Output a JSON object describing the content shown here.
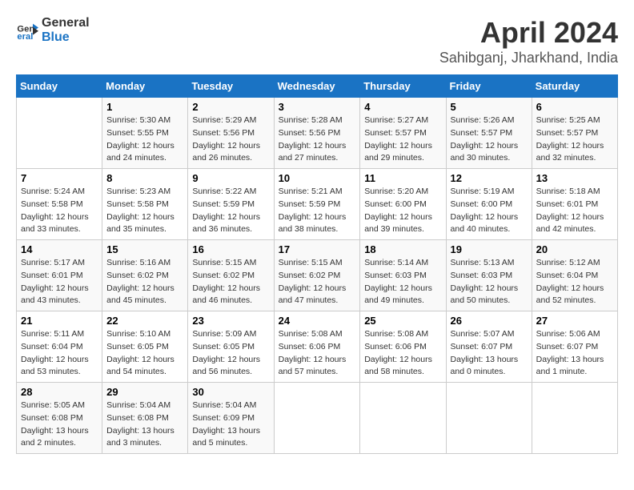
{
  "header": {
    "logo_line1": "General",
    "logo_line2": "Blue",
    "title": "April 2024",
    "subtitle": "Sahibganj, Jharkhand, India"
  },
  "weekdays": [
    "Sunday",
    "Monday",
    "Tuesday",
    "Wednesday",
    "Thursday",
    "Friday",
    "Saturday"
  ],
  "weeks": [
    [
      {
        "day": "",
        "detail": ""
      },
      {
        "day": "1",
        "detail": "Sunrise: 5:30 AM\nSunset: 5:55 PM\nDaylight: 12 hours\nand 24 minutes."
      },
      {
        "day": "2",
        "detail": "Sunrise: 5:29 AM\nSunset: 5:56 PM\nDaylight: 12 hours\nand 26 minutes."
      },
      {
        "day": "3",
        "detail": "Sunrise: 5:28 AM\nSunset: 5:56 PM\nDaylight: 12 hours\nand 27 minutes."
      },
      {
        "day": "4",
        "detail": "Sunrise: 5:27 AM\nSunset: 5:57 PM\nDaylight: 12 hours\nand 29 minutes."
      },
      {
        "day": "5",
        "detail": "Sunrise: 5:26 AM\nSunset: 5:57 PM\nDaylight: 12 hours\nand 30 minutes."
      },
      {
        "day": "6",
        "detail": "Sunrise: 5:25 AM\nSunset: 5:57 PM\nDaylight: 12 hours\nand 32 minutes."
      }
    ],
    [
      {
        "day": "7",
        "detail": "Sunrise: 5:24 AM\nSunset: 5:58 PM\nDaylight: 12 hours\nand 33 minutes."
      },
      {
        "day": "8",
        "detail": "Sunrise: 5:23 AM\nSunset: 5:58 PM\nDaylight: 12 hours\nand 35 minutes."
      },
      {
        "day": "9",
        "detail": "Sunrise: 5:22 AM\nSunset: 5:59 PM\nDaylight: 12 hours\nand 36 minutes."
      },
      {
        "day": "10",
        "detail": "Sunrise: 5:21 AM\nSunset: 5:59 PM\nDaylight: 12 hours\nand 38 minutes."
      },
      {
        "day": "11",
        "detail": "Sunrise: 5:20 AM\nSunset: 6:00 PM\nDaylight: 12 hours\nand 39 minutes."
      },
      {
        "day": "12",
        "detail": "Sunrise: 5:19 AM\nSunset: 6:00 PM\nDaylight: 12 hours\nand 40 minutes."
      },
      {
        "day": "13",
        "detail": "Sunrise: 5:18 AM\nSunset: 6:01 PM\nDaylight: 12 hours\nand 42 minutes."
      }
    ],
    [
      {
        "day": "14",
        "detail": "Sunrise: 5:17 AM\nSunset: 6:01 PM\nDaylight: 12 hours\nand 43 minutes."
      },
      {
        "day": "15",
        "detail": "Sunrise: 5:16 AM\nSunset: 6:02 PM\nDaylight: 12 hours\nand 45 minutes."
      },
      {
        "day": "16",
        "detail": "Sunrise: 5:15 AM\nSunset: 6:02 PM\nDaylight: 12 hours\nand 46 minutes."
      },
      {
        "day": "17",
        "detail": "Sunrise: 5:15 AM\nSunset: 6:02 PM\nDaylight: 12 hours\nand 47 minutes."
      },
      {
        "day": "18",
        "detail": "Sunrise: 5:14 AM\nSunset: 6:03 PM\nDaylight: 12 hours\nand 49 minutes."
      },
      {
        "day": "19",
        "detail": "Sunrise: 5:13 AM\nSunset: 6:03 PM\nDaylight: 12 hours\nand 50 minutes."
      },
      {
        "day": "20",
        "detail": "Sunrise: 5:12 AM\nSunset: 6:04 PM\nDaylight: 12 hours\nand 52 minutes."
      }
    ],
    [
      {
        "day": "21",
        "detail": "Sunrise: 5:11 AM\nSunset: 6:04 PM\nDaylight: 12 hours\nand 53 minutes."
      },
      {
        "day": "22",
        "detail": "Sunrise: 5:10 AM\nSunset: 6:05 PM\nDaylight: 12 hours\nand 54 minutes."
      },
      {
        "day": "23",
        "detail": "Sunrise: 5:09 AM\nSunset: 6:05 PM\nDaylight: 12 hours\nand 56 minutes."
      },
      {
        "day": "24",
        "detail": "Sunrise: 5:08 AM\nSunset: 6:06 PM\nDaylight: 12 hours\nand 57 minutes."
      },
      {
        "day": "25",
        "detail": "Sunrise: 5:08 AM\nSunset: 6:06 PM\nDaylight: 12 hours\nand 58 minutes."
      },
      {
        "day": "26",
        "detail": "Sunrise: 5:07 AM\nSunset: 6:07 PM\nDaylight: 13 hours\nand 0 minutes."
      },
      {
        "day": "27",
        "detail": "Sunrise: 5:06 AM\nSunset: 6:07 PM\nDaylight: 13 hours\nand 1 minute."
      }
    ],
    [
      {
        "day": "28",
        "detail": "Sunrise: 5:05 AM\nSunset: 6:08 PM\nDaylight: 13 hours\nand 2 minutes."
      },
      {
        "day": "29",
        "detail": "Sunrise: 5:04 AM\nSunset: 6:08 PM\nDaylight: 13 hours\nand 3 minutes."
      },
      {
        "day": "30",
        "detail": "Sunrise: 5:04 AM\nSunset: 6:09 PM\nDaylight: 13 hours\nand 5 minutes."
      },
      {
        "day": "",
        "detail": ""
      },
      {
        "day": "",
        "detail": ""
      },
      {
        "day": "",
        "detail": ""
      },
      {
        "day": "",
        "detail": ""
      }
    ]
  ]
}
